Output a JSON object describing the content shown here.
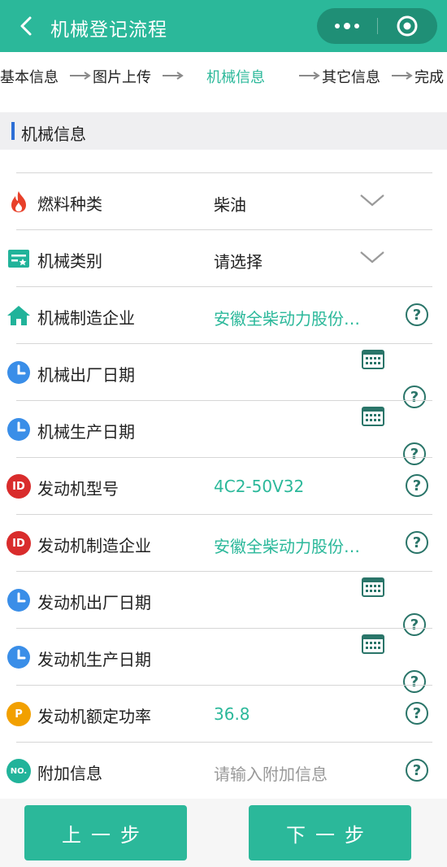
{
  "header": {
    "title": "机械登记流程"
  },
  "steps": [
    "基本信息",
    "图片上传",
    "机械信息",
    "其它信息",
    "完成"
  ],
  "section": {
    "title": "机械信息"
  },
  "fields": [
    {
      "label": "燃料种类",
      "value": "柴油",
      "icon": "fire-icon"
    },
    {
      "label": "机械类别",
      "value": "请选择",
      "icon": "category-icon"
    },
    {
      "label": "机械制造企业",
      "value": "安徽全柴动力股份…",
      "icon": "home-icon"
    },
    {
      "label": "机械出厂日期",
      "value": "",
      "icon": "clock-icon"
    },
    {
      "label": "机械生产日期",
      "value": "",
      "icon": "clock-icon"
    },
    {
      "label": "发动机型号",
      "value": "4C2-50V32",
      "icon": "id-icon"
    },
    {
      "label": "发动机制造企业",
      "value": "安徽全柴动力股份…",
      "icon": "id-icon"
    },
    {
      "label": "发动机出厂日期",
      "value": "",
      "icon": "clock-icon"
    },
    {
      "label": "发动机生产日期",
      "value": "",
      "icon": "clock-icon"
    },
    {
      "label": "发动机额定功率",
      "value": "36.8",
      "icon": "p-icon"
    },
    {
      "label": "附加信息",
      "placeholder": "请输入附加信息",
      "icon": "no-icon"
    }
  ],
  "badges": {
    "id": "ID",
    "p": "P",
    "no": "NO."
  },
  "help_glyph": "?",
  "footer": {
    "prev": "上一步",
    "next": "下一步"
  },
  "colors": {
    "primary": "#2bb89a",
    "accent_bar": "#2d6fd6",
    "fire": "#e8402a",
    "clock": "#3a8ee8",
    "id_red": "#d92c2c",
    "p_orange": "#f2a000"
  }
}
